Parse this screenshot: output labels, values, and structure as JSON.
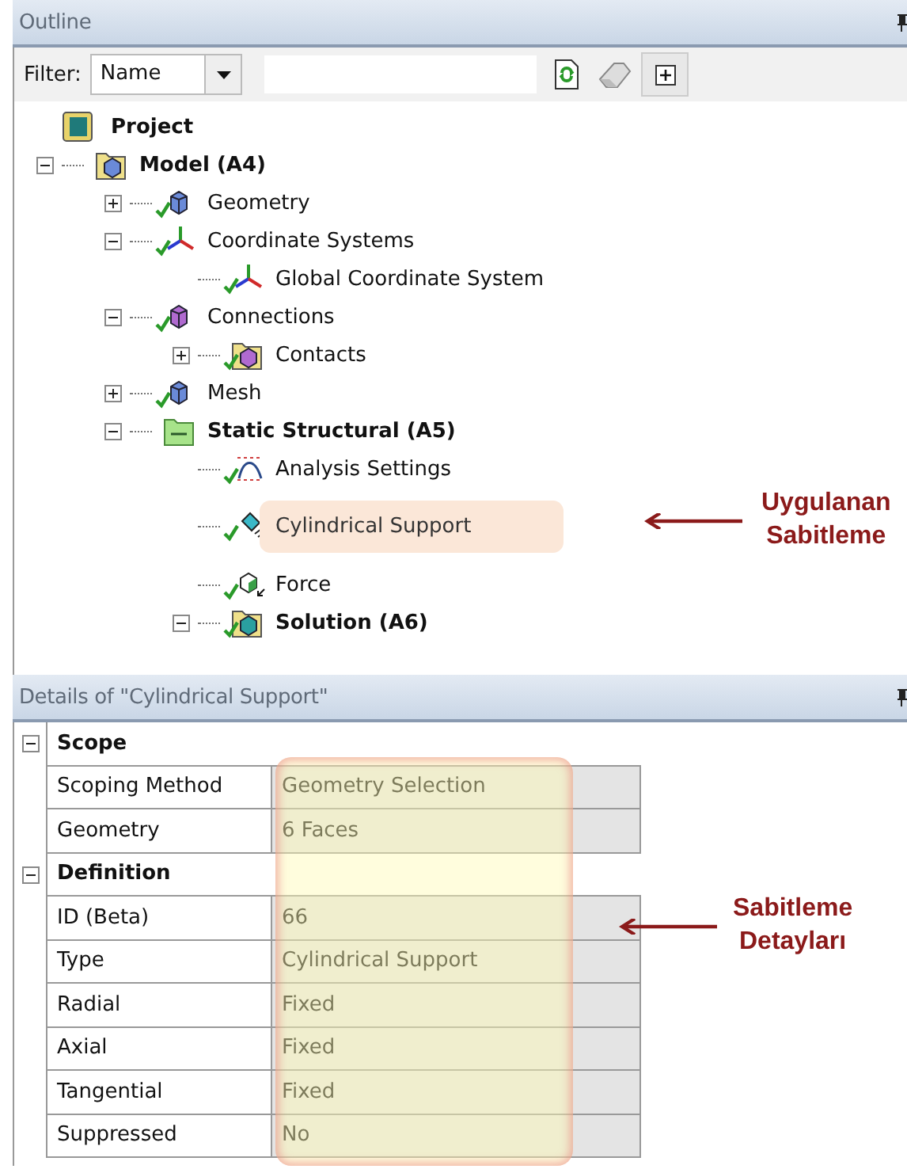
{
  "outline": {
    "title": "Outline",
    "filter": {
      "label": "Filter:",
      "mode": "Name"
    },
    "tree": [
      {
        "label": "Project",
        "kind": "project",
        "bold": true,
        "ok": false,
        "highlighted": false,
        "children": [
          {
            "label": "Model (A4)",
            "kind": "model",
            "bold": true,
            "ok": false,
            "highlighted": false,
            "expanded": true,
            "children": [
              {
                "label": "Geometry",
                "kind": "geometry",
                "bold": false,
                "ok": true,
                "highlighted": false,
                "expanded": false
              },
              {
                "label": "Coordinate Systems",
                "kind": "axes",
                "bold": false,
                "ok": true,
                "highlighted": false,
                "expanded": true,
                "children": [
                  {
                    "label": "Global Coordinate System",
                    "kind": "axes",
                    "bold": false,
                    "ok": true,
                    "highlighted": false
                  }
                ]
              },
              {
                "label": "Connections",
                "kind": "connections",
                "bold": false,
                "ok": true,
                "highlighted": false,
                "expanded": true,
                "children": [
                  {
                    "label": "Contacts",
                    "kind": "contacts",
                    "bold": false,
                    "ok": true,
                    "highlighted": false,
                    "expanded": false
                  }
                ]
              },
              {
                "label": "Mesh",
                "kind": "mesh",
                "bold": false,
                "ok": true,
                "highlighted": false,
                "expanded": false
              },
              {
                "label": "Static Structural (A5)",
                "kind": "environment",
                "bold": true,
                "ok": false,
                "highlighted": false,
                "expanded": true,
                "children": [
                  {
                    "label": "Analysis Settings",
                    "kind": "settings",
                    "bold": false,
                    "ok": true,
                    "highlighted": false
                  },
                  {
                    "label": "Cylindrical Support",
                    "kind": "support",
                    "bold": false,
                    "ok": true,
                    "highlighted": true
                  },
                  {
                    "label": "Force",
                    "kind": "force",
                    "bold": false,
                    "ok": true,
                    "highlighted": false
                  },
                  {
                    "label": "Solution (A6)",
                    "kind": "solution",
                    "bold": true,
                    "ok": true,
                    "highlighted": false,
                    "expanded": true
                  }
                ]
              }
            ]
          }
        ]
      }
    ],
    "annotation": "Uygulanan\nSabitleme"
  },
  "details": {
    "title": "Details of \"Cylindrical Support\"",
    "values_highlighted": true,
    "sections": [
      {
        "title": "Scope",
        "expanded": true,
        "rows": [
          {
            "label": "Scoping Method",
            "value": "Geometry Selection"
          },
          {
            "label": "Geometry",
            "value": "6 Faces"
          }
        ]
      },
      {
        "title": "Definition",
        "expanded": true,
        "rows": [
          {
            "label": "ID (Beta)",
            "value": "66"
          },
          {
            "label": "Type",
            "value": "Cylindrical Support"
          },
          {
            "label": "Radial",
            "value": "Fixed"
          },
          {
            "label": "Axial",
            "value": "Fixed"
          },
          {
            "label": "Tangential",
            "value": "Fixed"
          },
          {
            "label": "Suppressed",
            "value": "No"
          }
        ]
      }
    ],
    "annotation": "Sabitleme\nDetayları"
  }
}
